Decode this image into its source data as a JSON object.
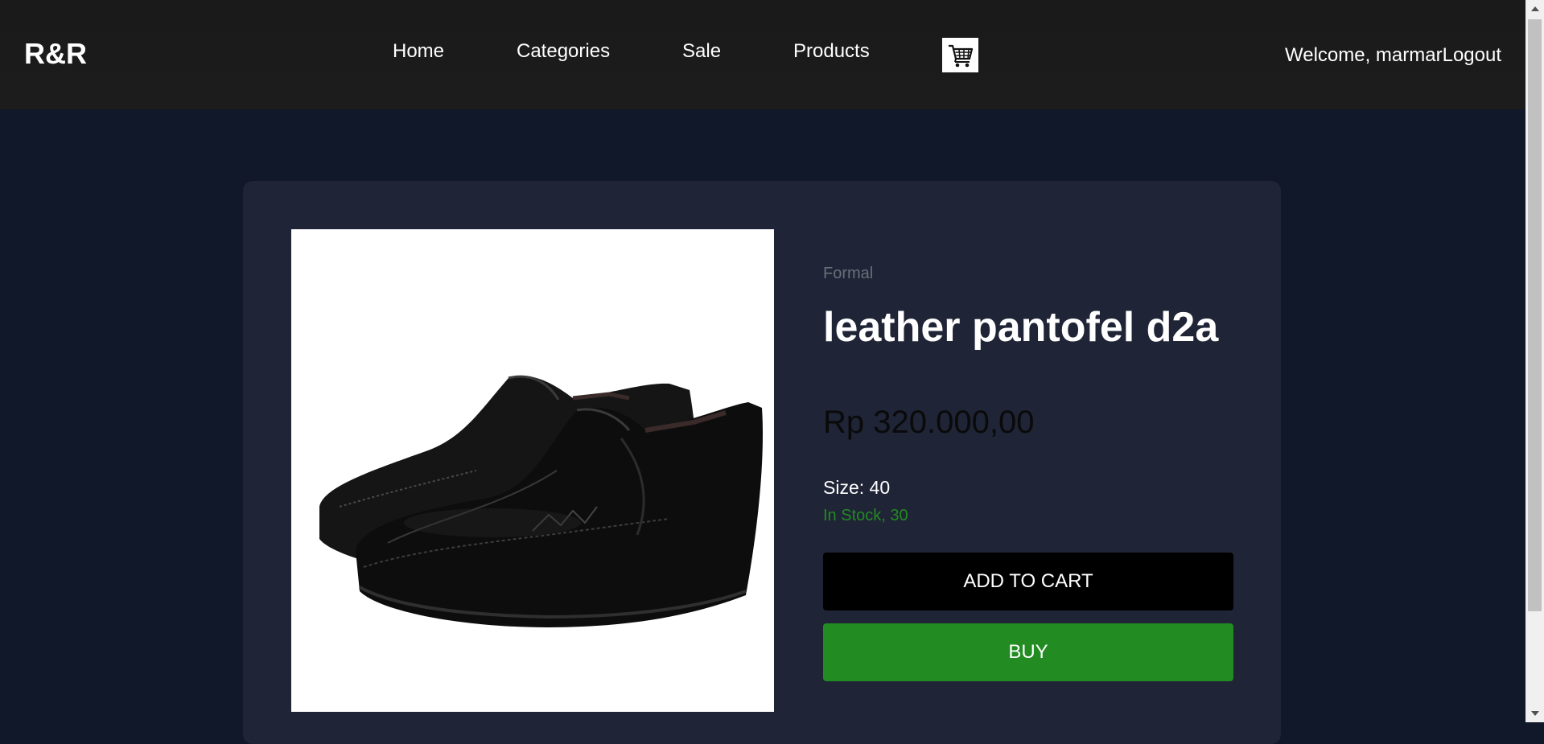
{
  "header": {
    "logo": "R&R",
    "nav": [
      "Home",
      "Categories",
      "Sale",
      "Products"
    ],
    "cart_icon": "shopping-cart-icon",
    "welcome_text": "Welcome, marmar",
    "logout_label": "Logout"
  },
  "product": {
    "image_icon": "black-leather-loafer-shoe",
    "category": "Formal",
    "title": "leather pantofel d2a",
    "price": "Rp 320.000,00",
    "size": "Size: 40",
    "stock": "In Stock, 30",
    "add_to_cart_label": "ADD TO CART",
    "buy_label": "BUY"
  },
  "colors": {
    "header_bg": "#1c1c1c",
    "page_bg": "#111829",
    "card_bg": "#1f2436",
    "stock_green": "#228b22",
    "buy_green": "#228b22"
  }
}
